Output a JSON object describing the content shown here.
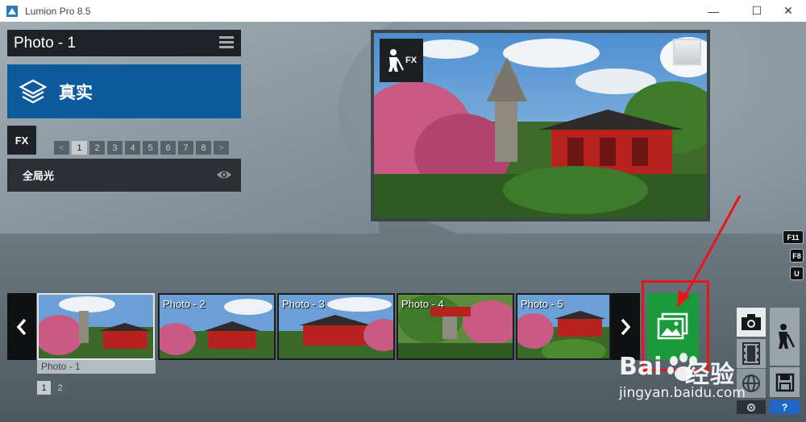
{
  "window": {
    "title": "Lumion Pro 8.5",
    "minimize_glyph": "—",
    "maximize_glyph": "☐",
    "close_glyph": "✕"
  },
  "left_panel": {
    "photo_title": "Photo - 1",
    "style_label": "真实",
    "fx_label": "FX",
    "pager": {
      "prev": "<",
      "pages": [
        "1",
        "2",
        "3",
        "4",
        "5",
        "6",
        "7",
        "8"
      ],
      "active_page": "1",
      "next": ">"
    },
    "effect_name": "全局光"
  },
  "preview": {
    "fx_label": "FX"
  },
  "shortcuts": [
    "F11",
    "F8",
    "U"
  ],
  "film_strip": {
    "thumbnails": [
      {
        "label": "Photo - 1",
        "selected": true
      },
      {
        "label": "Photo - 2",
        "selected": false
      },
      {
        "label": "Photo - 3",
        "selected": false
      },
      {
        "label": "Photo - 4",
        "selected": false
      },
      {
        "label": "Photo - 5",
        "selected": false
      }
    ],
    "selected_caption": "Photo - 1",
    "pages": [
      "1",
      "2"
    ],
    "active_page": "1"
  },
  "right_buttons": {
    "help_label": "?"
  },
  "watermark": {
    "brand": "Bai",
    "brand_cn": "经验",
    "url": "jingyan.baidu.com"
  },
  "colors": {
    "style_banner": "#0d5a9c",
    "render_button": "#1a9a3a",
    "annotation_red": "#e8161b",
    "help_button": "#1f66c8"
  },
  "icons": {
    "app": "lumion-logo-icon",
    "menu": "hamburger-menu-icon",
    "style": "layers-icon",
    "visibility": "eye-icon",
    "fx_mode": "gardener-icon",
    "render": "image-gallery-icon",
    "photo_mode": "camera-icon",
    "movie_mode": "film-icon",
    "build_mode": "worker-icon",
    "save": "floppy-disk-icon",
    "settings": "gear-icon"
  }
}
